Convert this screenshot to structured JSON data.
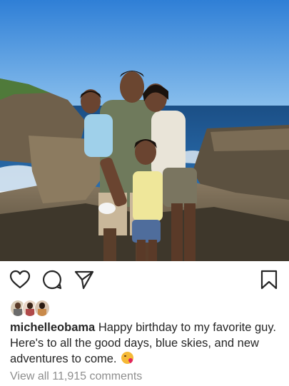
{
  "post": {
    "username": "michelleobama",
    "caption_text": "Happy birthday to my favorite guy. Here's to all the good days, blue skies, and new adventures to come.",
    "emoji": "kiss-heart-emoji",
    "view_comments_label": "View all 11,915 comments"
  },
  "actions": {
    "like_icon": "heart-icon",
    "comment_icon": "comment-icon",
    "share_icon": "paper-plane-icon",
    "save_icon": "bookmark-icon"
  },
  "colors": {
    "text": "#262626",
    "secondary_text": "#8e8e8e",
    "sky": "#3f8ee0",
    "ocean": "#1f5f9e"
  }
}
